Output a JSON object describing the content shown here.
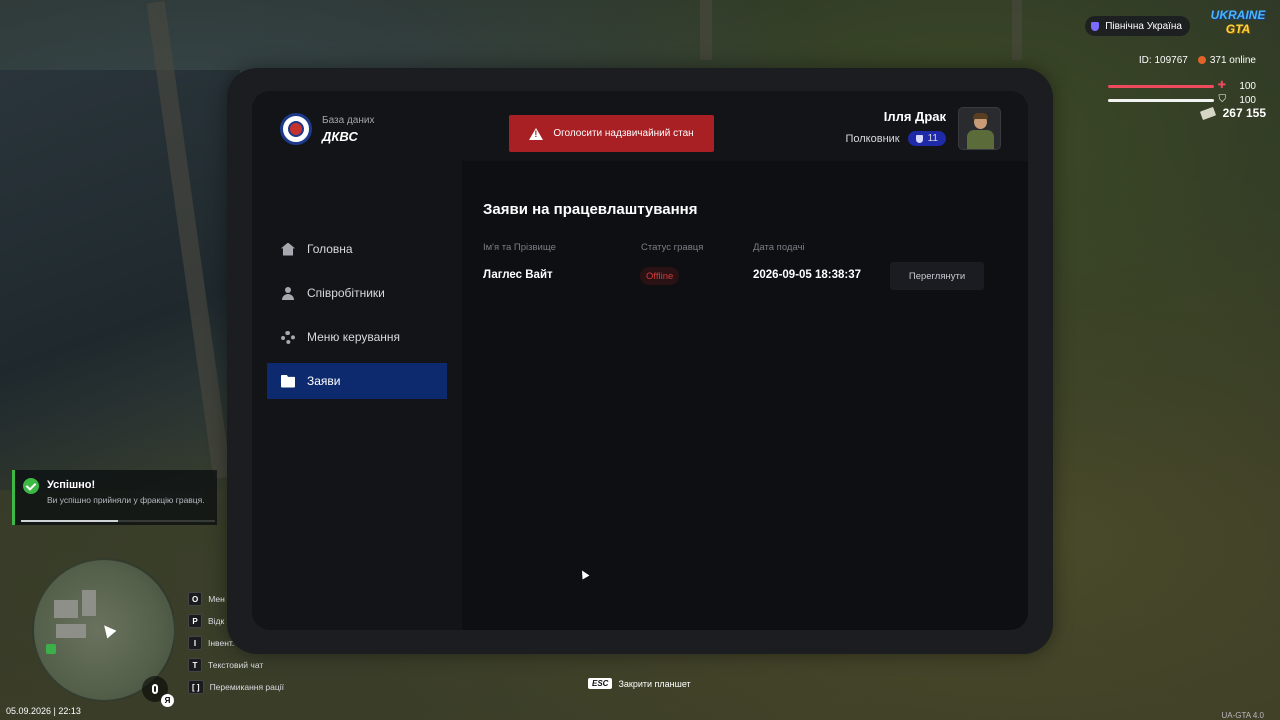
{
  "hud": {
    "region": "Північна Україна",
    "logo_line1": "UKRAINE",
    "logo_line2": "GTA",
    "player_id": "ID: 109767",
    "online": "371 online",
    "health": "100",
    "armor": "100",
    "health_level": 1.0,
    "armor_level": 1.0,
    "money": "267 155"
  },
  "tablet": {
    "brand_subtitle": "База даних",
    "brand_title": "ДКВС",
    "emergency_button": "Оголосити надзвичайний стан",
    "user_name": "Ілля Драк",
    "user_rank": "Полковник",
    "rank_level": "11",
    "nav": [
      {
        "label": "Головна",
        "icon": "home-icon"
      },
      {
        "label": "Співробітники",
        "icon": "users-icon"
      },
      {
        "label": "Меню керування",
        "icon": "gear-icon"
      },
      {
        "label": "Заяви",
        "icon": "folder-icon",
        "active": true
      }
    ],
    "section_title": "Заяви на працевлаштування",
    "table": {
      "columns": [
        "Ім'я та Прізвище",
        "Статус гравця",
        "Дата подачі"
      ],
      "rows": [
        {
          "name": "Лаглес Вайт",
          "status": "Offline",
          "date": "2026-09-05 18:38:37",
          "action": "Переглянути"
        }
      ]
    }
  },
  "notification": {
    "title": "Успішно!",
    "text": "Ви успішно прийняли у фракцію гравця.",
    "progress": 0.5
  },
  "keybinds": [
    {
      "key": "O",
      "label": "Мен"
    },
    {
      "key": "P",
      "label": "Відк"
    },
    {
      "key": "I",
      "label": "Інвент."
    },
    {
      "key": "T",
      "label": "Текстовий чат"
    },
    {
      "key": "[ ]",
      "label": "Перемикання рації"
    }
  ],
  "mic_key": "Я",
  "datetime": "05.09.2026 | 22:13",
  "esc": {
    "key": "ESC",
    "label": "Закрити планшет"
  },
  "version": "UA-GTA 4.0",
  "colors": {
    "accent": "#0e2a6e",
    "emergency": "#a81f24",
    "offline": "#d23b3b",
    "success": "#3db845",
    "rank_badge": "#1f2aa8"
  }
}
